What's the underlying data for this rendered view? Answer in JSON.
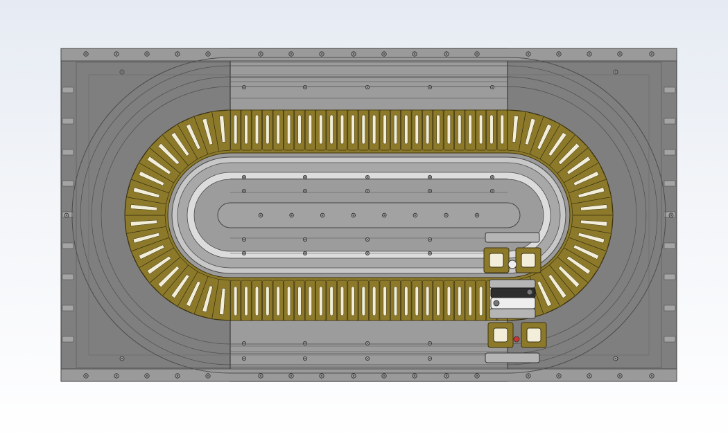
{
  "view": {
    "background_top": "#e6ebf3",
    "background_bottom": "#ffffff"
  },
  "assembly": {
    "plate_color": "#8d8d8d",
    "plate_dark": "#7f7f7f",
    "plate_light": "#9c9c9c",
    "edge_color": "#3a3a3a",
    "coil_color": "#8c7a2a",
    "coil_edge": "#3b3212",
    "slot_color": "#f2eed9",
    "inner_ring_color": "#c8c8c8",
    "mover_metal": "#b5b5b5",
    "mover_dark": "#2e2e2e",
    "mover_light": "#eeeeee",
    "straight_coil_count_top": 26,
    "straight_coil_count_bottom": 26,
    "curved_coil_count": 18,
    "center_rail_bolt_count": 8
  },
  "components": [
    {
      "id": "base-plate",
      "icon": "base-plate-icon"
    },
    {
      "id": "oval-coil-track",
      "icon": "coil-icon"
    },
    {
      "id": "inner-guide-rail",
      "icon": "rail-icon"
    },
    {
      "id": "linear-mover-carriage",
      "icon": "carriage-icon"
    }
  ]
}
